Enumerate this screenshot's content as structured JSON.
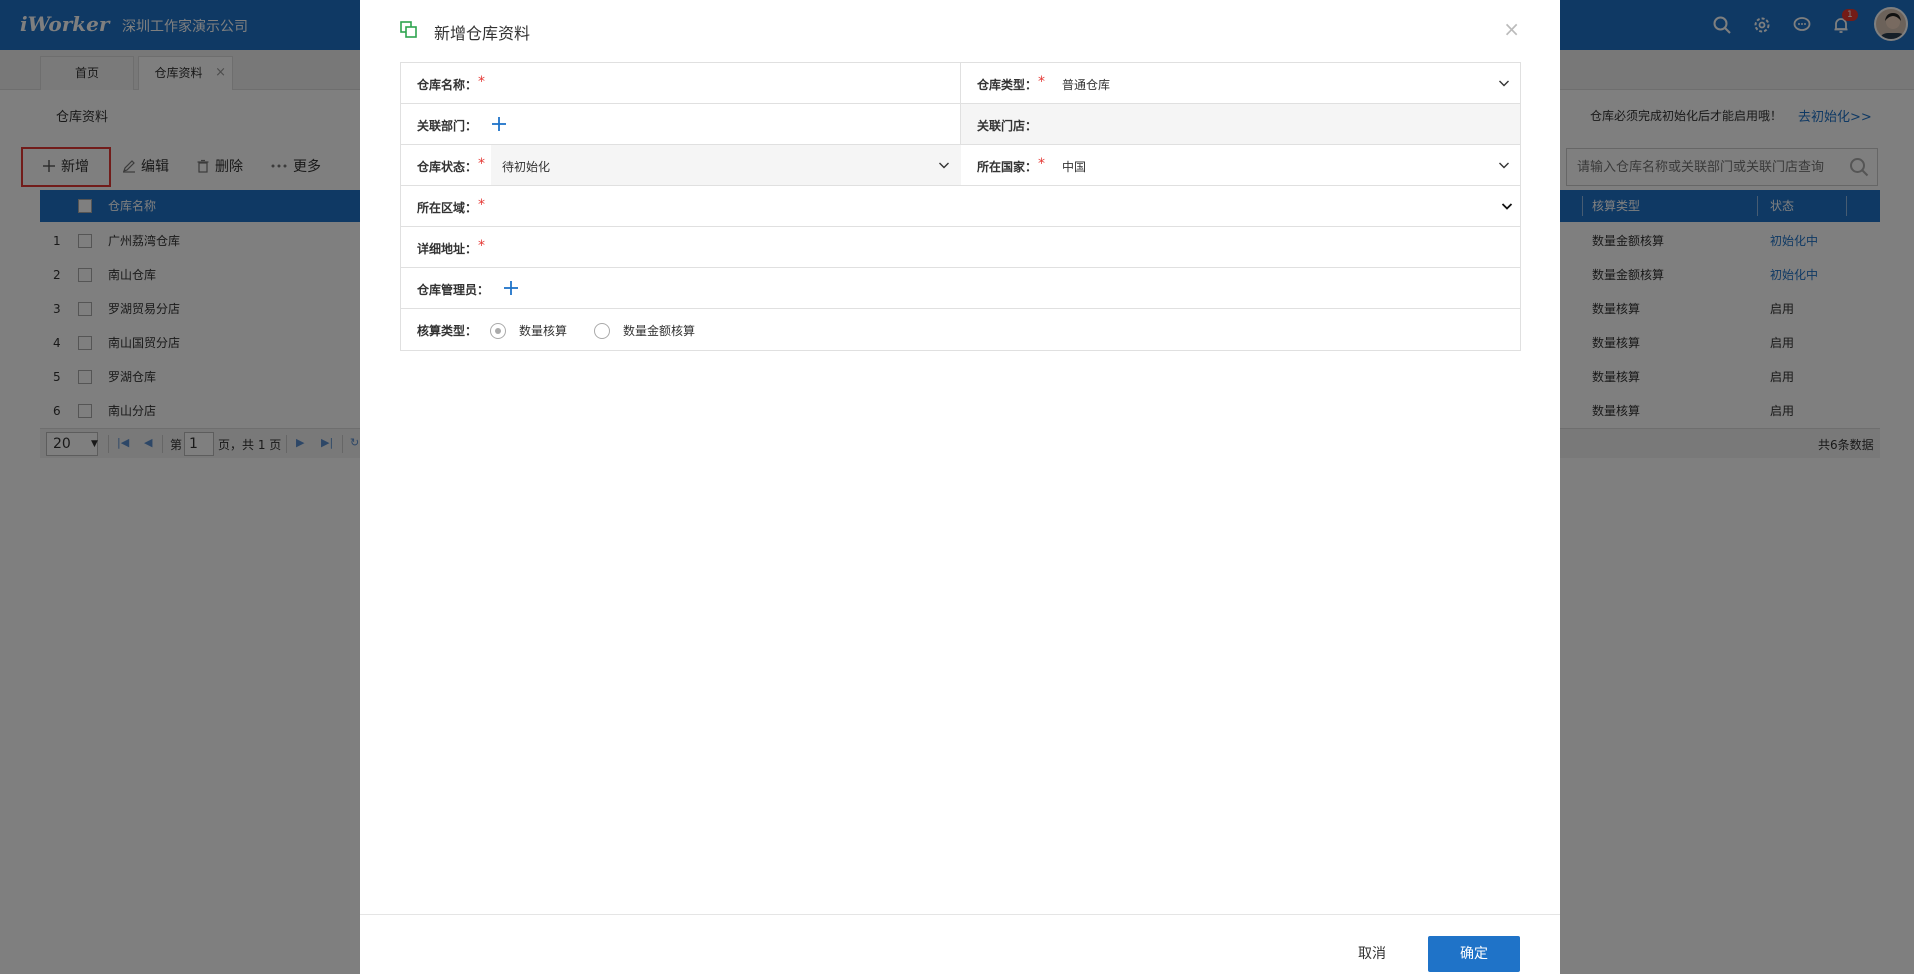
{
  "app": {
    "logo": "iWorker",
    "company": "深圳工作家演示公司",
    "notification_count": "1"
  },
  "tabs": [
    {
      "label": "首页"
    },
    {
      "label": "仓库资料",
      "close": "×"
    }
  ],
  "page": {
    "title": "仓库资料",
    "notice": "仓库必须完成初始化后才能启用哦！",
    "notice_link": "去初始化>>"
  },
  "toolbar": {
    "add": "新增",
    "edit": "编辑",
    "delete": "删除",
    "more": "更多"
  },
  "search": {
    "placeholder": "请输入仓库名称或关联部门或关联门店查询"
  },
  "grid": {
    "columns": {
      "name": "仓库名称",
      "calc": "核算类型",
      "status": "状态"
    },
    "rows": [
      {
        "no": "1",
        "name": "广州荔湾仓库",
        "calc": "数量金额核算",
        "status": "初始化中"
      },
      {
        "no": "2",
        "name": "南山仓库",
        "calc": "数量金额核算",
        "status": "初始化中"
      },
      {
        "no": "3",
        "name": "罗湖贸易分店",
        "calc": "数量核算",
        "status": "启用"
      },
      {
        "no": "4",
        "name": "南山国贸分店",
        "calc": "数量核算",
        "status": "启用"
      },
      {
        "no": "5",
        "name": "罗湖仓库",
        "calc": "数量核算",
        "status": "启用"
      },
      {
        "no": "6",
        "name": "南山分店",
        "calc": "数量核算",
        "status": "启用"
      }
    ]
  },
  "pager": {
    "page_size": "20",
    "page_prefix": "第",
    "page_value": "1",
    "page_suffix": "页，共 1 页",
    "total": "共6条数据"
  },
  "modal": {
    "title": "新增仓库资料",
    "close": "×",
    "fields": {
      "name_label": "仓库名称：",
      "type_label": "仓库类型：",
      "type_value": "普通仓库",
      "dept_label": "关联部门：",
      "store_label": "关联门店：",
      "status_label": "仓库状态：",
      "status_value": "待初始化",
      "country_label": "所在国家：",
      "country_value": "中国",
      "region_label": "所在区域：",
      "address_label": "详细地址：",
      "admin_label": "仓库管理员：",
      "calc_label": "核算类型：",
      "calc_opt1": "数量核算",
      "calc_opt2": "数量金额核算"
    },
    "required_mark": "*",
    "cancel": "取消",
    "ok": "确定"
  },
  "colors": {
    "primary": "#1f73c8",
    "required": "#e53935",
    "highlight": "#e53935"
  }
}
